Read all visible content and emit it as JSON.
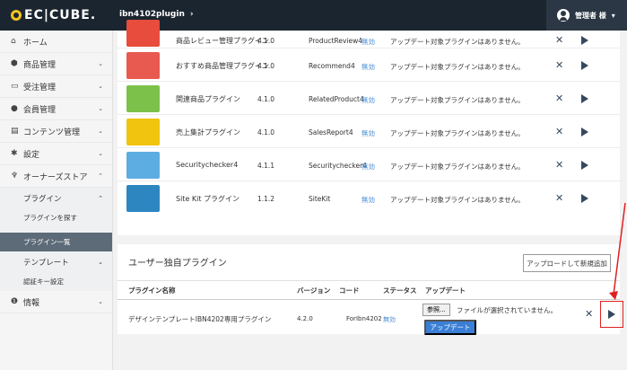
{
  "header": {
    "logo_text": "EC|CUBE.",
    "breadcrumb": "ibn4102plugin",
    "breadcrumb_chevron": "›",
    "user_name": "管理者 様",
    "user_chevron": "▾"
  },
  "sidebar": {
    "items": [
      {
        "icon": "⌂",
        "label": "ホーム",
        "arrow": ""
      },
      {
        "icon": "⬢",
        "label": "商品管理",
        "arrow": "⌄"
      },
      {
        "icon": "▭",
        "label": "受注管理",
        "arrow": "⌄"
      },
      {
        "icon": "●",
        "label": "会員管理",
        "arrow": "⌄"
      },
      {
        "icon": "▤",
        "label": "コンテンツ管理",
        "arrow": "⌄"
      },
      {
        "icon": "✱",
        "label": "設定",
        "arrow": "⌄"
      },
      {
        "icon": "♆",
        "label": "オーナーズストア",
        "arrow": "⌃"
      }
    ],
    "sub_plugin": "プラグイン",
    "sub_plugin_arrow": "⌃",
    "sub_find": "プラグインを探す",
    "sub_list": "プラグイン一覧",
    "sub_template": "テンプレート",
    "sub_template_arrow": "⌄",
    "sub_auth": "認証キー設定",
    "info": {
      "icon": "❶",
      "label": "情報",
      "arrow": "⌄"
    }
  },
  "plugins": [
    {
      "name": "商品レビュー管理プラグイン",
      "version": "4.1.0",
      "code": "ProductReview4",
      "status": "無効",
      "update": "アップデート対象プラグインはありません。",
      "thumb_color": "#e74c3c"
    },
    {
      "name": "おすすめ商品管理プラグイン",
      "version": "4.1.0",
      "code": "Recommend4",
      "status": "無効",
      "update": "アップデート対象プラグインはありません。",
      "thumb_color": "#e85a4f"
    },
    {
      "name": "関連商品プラグイン",
      "version": "4.1.0",
      "code": "RelatedProduct4",
      "status": "無効",
      "update": "アップデート対象プラグインはありません。",
      "thumb_color": "#7cc24a"
    },
    {
      "name": "売上集計プラグイン",
      "version": "4.1.0",
      "code": "SalesReport4",
      "status": "無効",
      "update": "アップデート対象プラグインはありません。",
      "thumb_color": "#f1c40f"
    },
    {
      "name": "Securitychecker4",
      "version": "4.1.1",
      "code": "Securitychecker4",
      "status": "無効",
      "update": "アップデート対象プラグインはありません。",
      "thumb_color": "#5dade2"
    },
    {
      "name": "Site Kit プラグイン",
      "version": "1.1.2",
      "code": "SiteKit",
      "status": "無効",
      "update": "アップデート対象プラグインはありません。",
      "thumb_color": "#2e86c1"
    }
  ],
  "custom": {
    "title": "ユーザー独自プラグイン",
    "upload_label": "アップロードして新規追加",
    "headers": {
      "name": "プラグイン名称",
      "version": "バージョン",
      "code": "コード",
      "status": "ステータス",
      "update": "アップデート"
    },
    "row": {
      "name": "デザインテンプレートIBN4202専用プラグイン",
      "version": "4.2.0",
      "code": "ForIbn4202",
      "status": "無効",
      "file_button": "参照...",
      "file_text": "ファイルが選択されていません。",
      "update_button": "アップデート"
    }
  },
  "icons": {
    "delete": "✕",
    "enable": "play-icon"
  },
  "colors": {
    "header_bg": "#1b2530",
    "accent_blue": "#3a7fd5",
    "highlight_red": "#e02020"
  }
}
